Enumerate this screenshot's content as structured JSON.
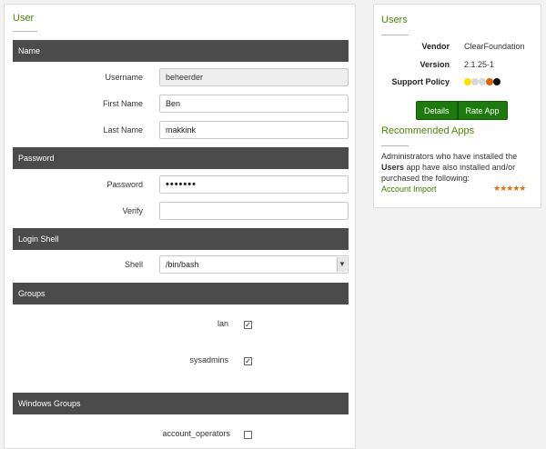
{
  "main": {
    "title": "User",
    "sections": {
      "name": "Name",
      "password": "Password",
      "login_shell": "Login Shell",
      "groups": "Groups",
      "windows_groups": "Windows Groups"
    },
    "fields": {
      "username": {
        "label": "Username",
        "value": "beheerder"
      },
      "first_name": {
        "label": "First Name",
        "value": "Ben"
      },
      "last_name": {
        "label": "Last Name",
        "value": "makkink"
      },
      "password": {
        "label": "Password",
        "value": "•••••••"
      },
      "verify": {
        "label": "Verify",
        "value": ""
      },
      "shell": {
        "label": "Shell",
        "value": "/bin/bash"
      }
    },
    "groups": [
      {
        "label": "lan",
        "checked": true
      },
      {
        "label": "sysadmins",
        "checked": true
      }
    ],
    "windows_groups": [
      {
        "label": "account_operators",
        "checked": false
      }
    ]
  },
  "sidebar": {
    "title": "Users",
    "vendor_label": "Vendor",
    "vendor_value": "ClearFoundation",
    "version_label": "Version",
    "version_value": "2.1.25-1",
    "support_label": "Support Policy",
    "support_dots": [
      "#f2e600",
      "#d8d8d8",
      "#d8d8d8",
      "#e06000",
      "#111111"
    ],
    "details_button": "Details",
    "rate_button": "Rate App",
    "recommended_title": "Recommended Apps",
    "recommended_text_pre": "Administrators who have installed the ",
    "recommended_text_bold": "Users",
    "recommended_text_post": " app have also installed and/or purchased the following:",
    "recommended_link": "Account Import",
    "recommended_rating": "★★★★★"
  },
  "colors": {
    "accent": "#4c8a00",
    "section_bar": "#4b4b4b",
    "button": "#1d7a0c",
    "star": "#e07000"
  }
}
